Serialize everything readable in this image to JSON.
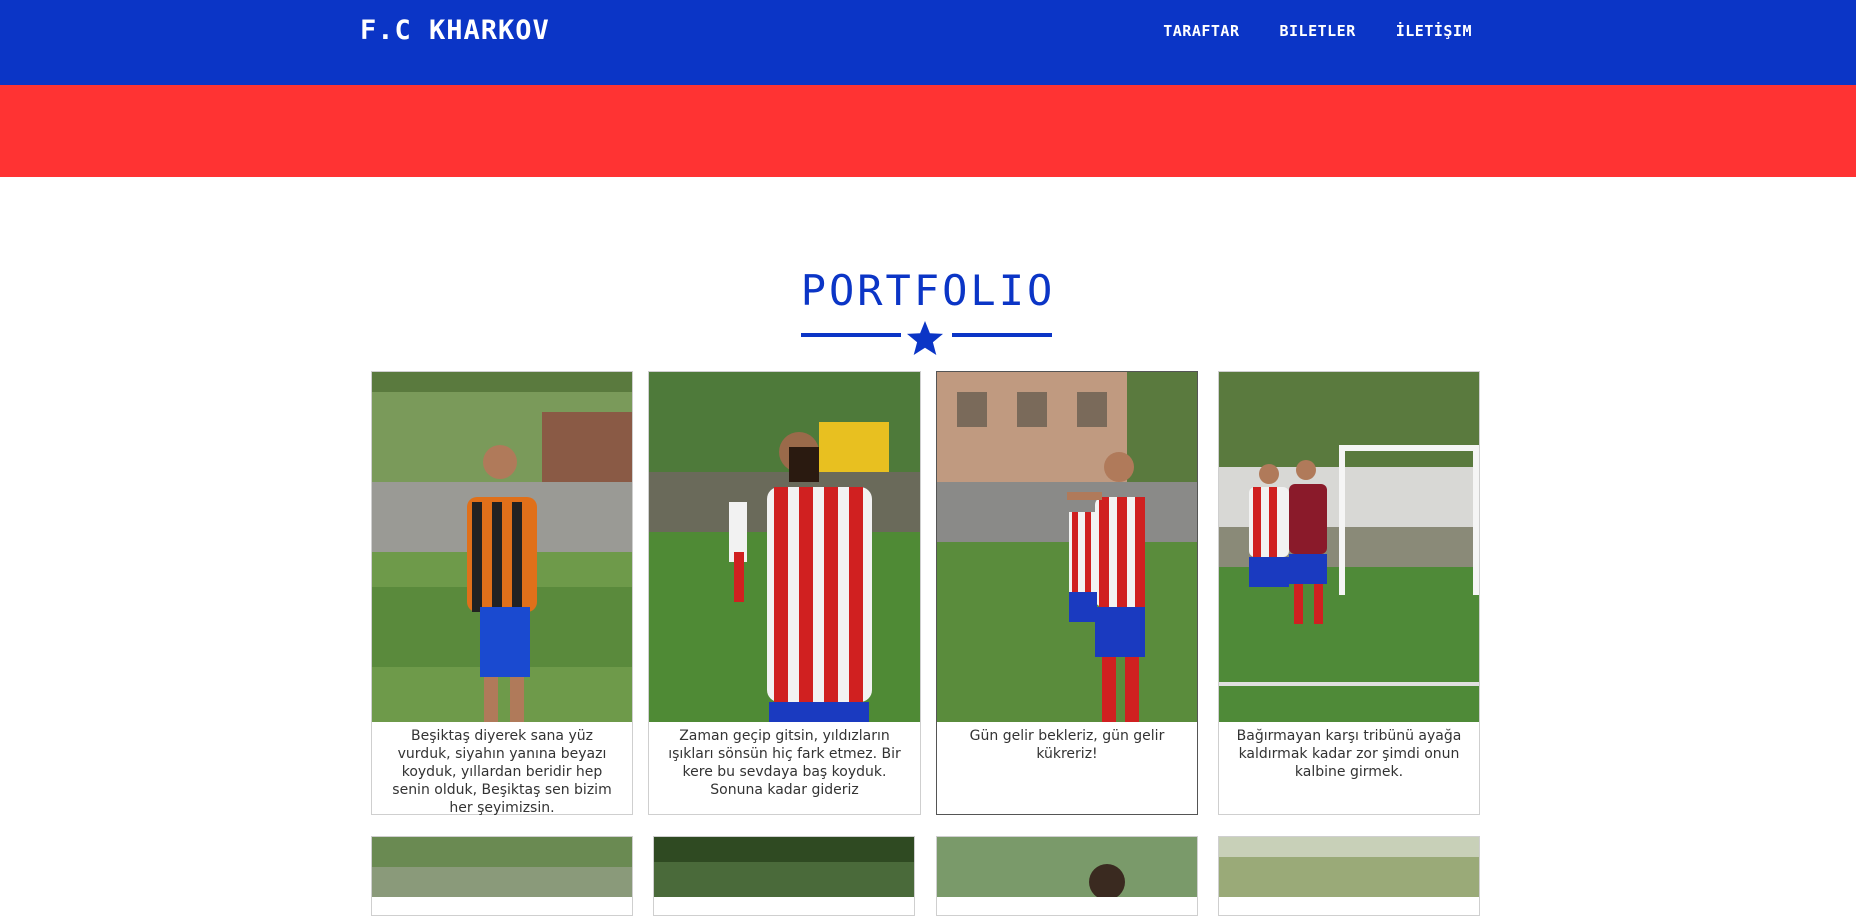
{
  "header": {
    "brand": "F.C KHARKOV",
    "nav": [
      {
        "label": "TARAFTAR"
      },
      {
        "label": "BILETLER"
      },
      {
        "label": "İLETİŞIM"
      }
    ]
  },
  "portfolio": {
    "title": "PORTFOLIO",
    "items": [
      {
        "caption": "Beşiktaş diyerek sana yüz vurduk, siyahın yanına beyazı koyduk, yıllardan beridir hep senin olduk, Beşiktaş sen bizim her şeyimizsin."
      },
      {
        "caption": "Zaman geçip gitsin, yıldızların ışıkları sönsün hiç fark etmez. Bir kere bu sevdaya baş koyduk. Sonuna kadar gideriz"
      },
      {
        "caption": "Gün gelir bekleriz, gün gelir kükreriz!"
      },
      {
        "caption": "Bağırmayan karşı tribünü ayağa kaldırmak kadar zor şimdi onun kalbine girmek."
      }
    ]
  },
  "colors": {
    "primary": "#0b35c6",
    "accent": "#ff3333"
  }
}
